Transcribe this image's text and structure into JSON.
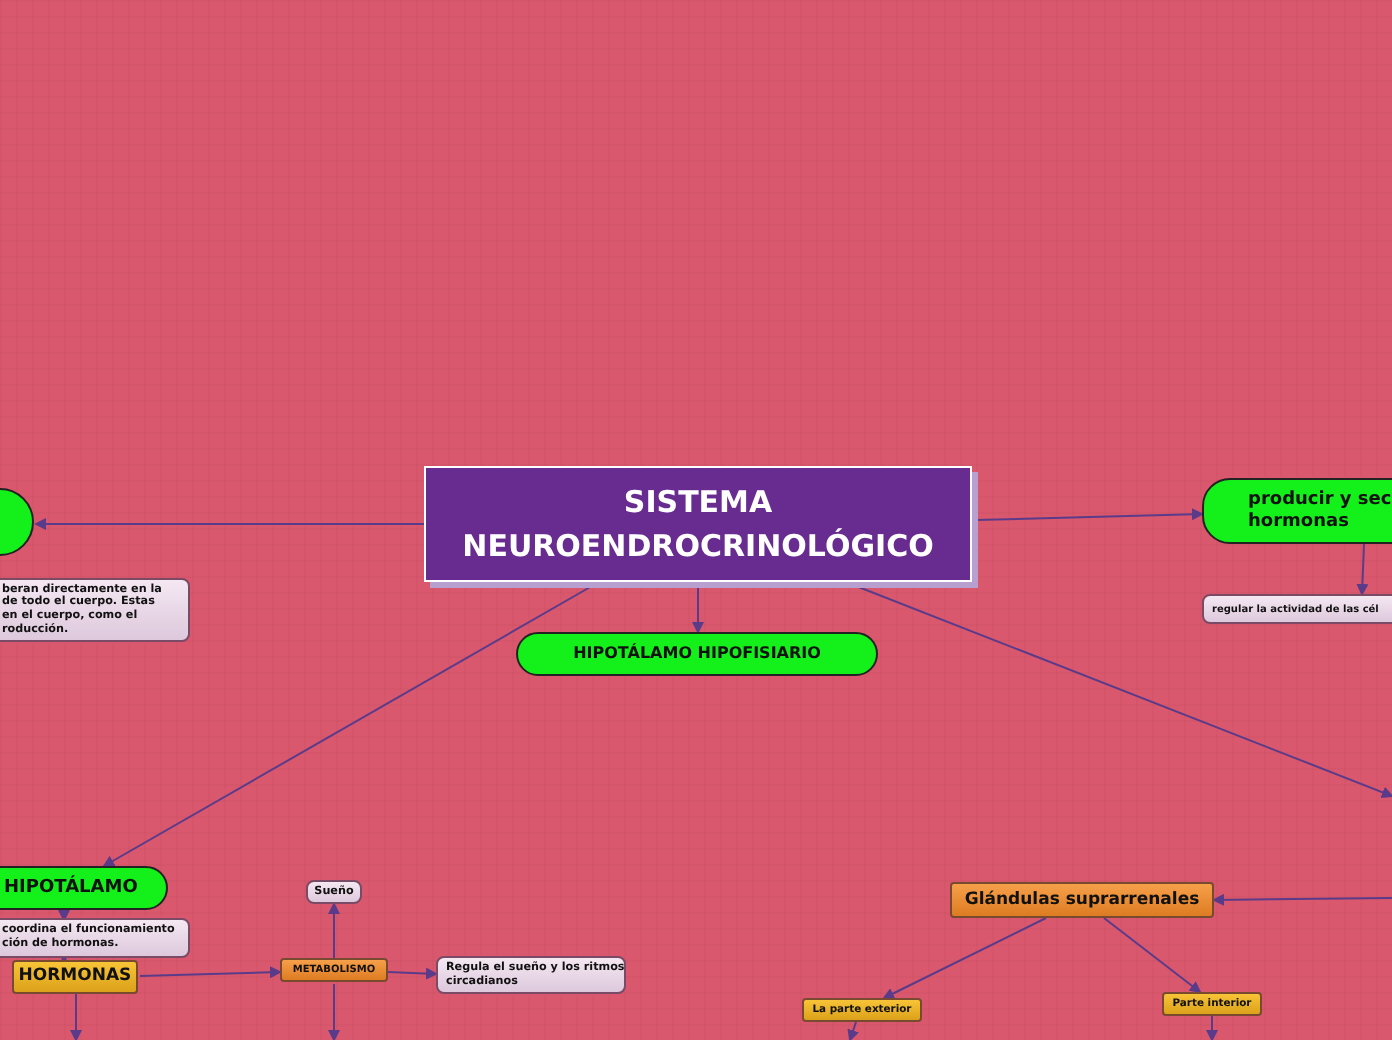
{
  "map": {
    "nodes": [
      {
        "kind": "central",
        "lines": [
          "SISTEMA",
          "NEUROENDROCRINOLÓGICO"
        ]
      },
      {
        "kind": "note",
        "lines": [
          "beran directamente en la",
          "de todo el cuerpo. Estas",
          "en el cuerpo, como el",
          "roducción."
        ]
      },
      {
        "kind": "green",
        "lines": [
          "HIPOTÁLAMO HIPOFISIARIO"
        ]
      },
      {
        "kind": "green",
        "lines": [
          "producir y sec",
          "hormonas"
        ]
      },
      {
        "kind": "note",
        "lines": [
          "regular la actividad de las cél"
        ]
      },
      {
        "kind": "green",
        "lines": [
          "HIPOTÁLAMO"
        ]
      },
      {
        "kind": "note",
        "lines": [
          "coordina el funcionamiento",
          "ción de hormonas."
        ]
      },
      {
        "kind": "note",
        "lines": [
          "Sueño"
        ]
      },
      {
        "kind": "yellow",
        "lines": [
          "HORMONAS"
        ]
      },
      {
        "kind": "orange",
        "lines": [
          "METABOLISMO"
        ]
      },
      {
        "kind": "note",
        "lines": [
          "Regula el sueño y los ritmos",
          "circadianos"
        ]
      },
      {
        "kind": "orange",
        "lines": [
          "Glándulas suprarrenales"
        ]
      },
      {
        "kind": "yellow",
        "lines": [
          "La parte exterior"
        ]
      },
      {
        "kind": "yellow",
        "lines": [
          "Parte interior"
        ]
      }
    ]
  }
}
